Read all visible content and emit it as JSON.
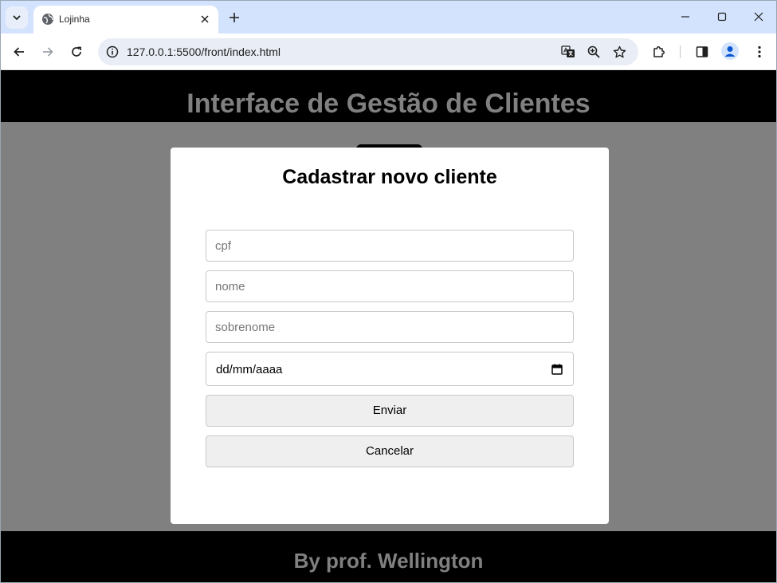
{
  "browser": {
    "tab_title": "Lojinha",
    "url": "127.0.0.1:5500/front/index.html"
  },
  "page": {
    "header_title": "Interface de Gestão de Clientes",
    "footer_text": "By prof. Wellington"
  },
  "modal": {
    "title": "Cadastrar novo cliente",
    "fields": {
      "cpf_placeholder": "cpf",
      "nome_placeholder": "nome",
      "sobrenome_placeholder": "sobrenome",
      "date_text": "dd/mm/aaaa"
    },
    "submit_label": "Enviar",
    "cancel_label": "Cancelar"
  },
  "colors": {
    "tabstrip": "#d3e3fd",
    "page_background": "#808080",
    "header_background": "#000000",
    "header_text": "#808080"
  }
}
